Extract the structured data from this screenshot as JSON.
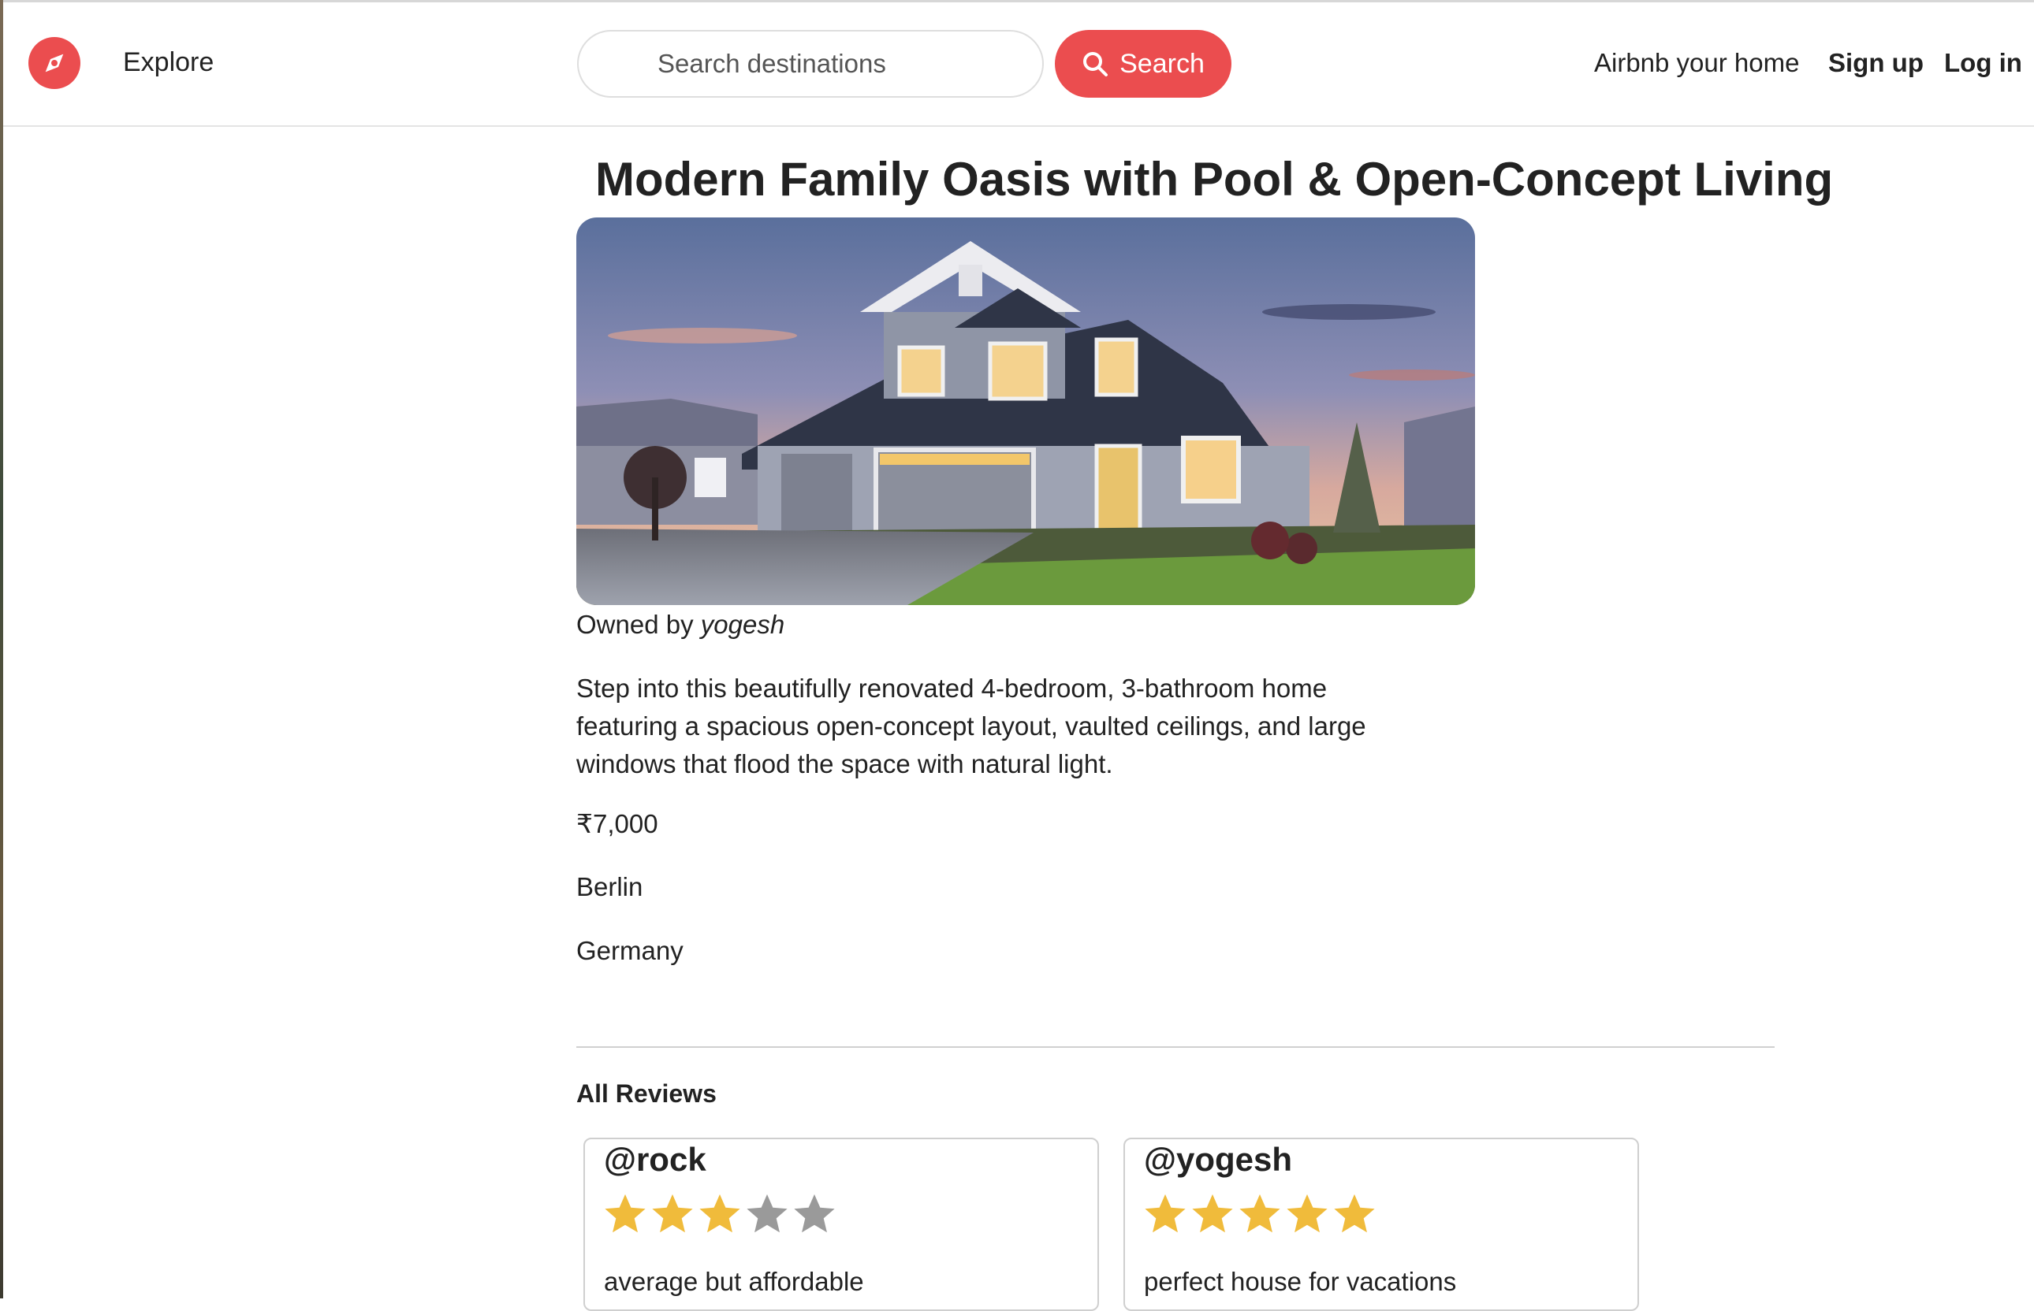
{
  "colors": {
    "brand": "#eb4d4f",
    "star_filled": "#f0bb3b",
    "star_empty": "#9a9a9a"
  },
  "nav": {
    "logo_icon": "compass-icon",
    "explore_label": "Explore",
    "search_placeholder": "Search destinations",
    "search_button_label": "Search",
    "host_link": "Airbnb your home",
    "signup_link": "Sign up",
    "login_link": "Log in"
  },
  "listing": {
    "title": "Modern Family Oasis with Pool & Open-Concept Living",
    "owner_prefix": "Owned by",
    "owner_name": "yogesh",
    "description": "Step into this beautifully renovated 4-bedroom, 3-bathroom home featuring a spacious open-concept layout, vaulted ceilings, and large windows that flood the space with natural light.",
    "price": "₹7,000",
    "location": "Berlin",
    "country": "Germany"
  },
  "reviews": {
    "heading": "All Reviews",
    "items": [
      {
        "author": "@rock",
        "rating": 3,
        "max_rating": 5,
        "comment": "average but affordable"
      },
      {
        "author": "@yogesh",
        "rating": 5,
        "max_rating": 5,
        "comment": "perfect house for vacations"
      }
    ]
  }
}
